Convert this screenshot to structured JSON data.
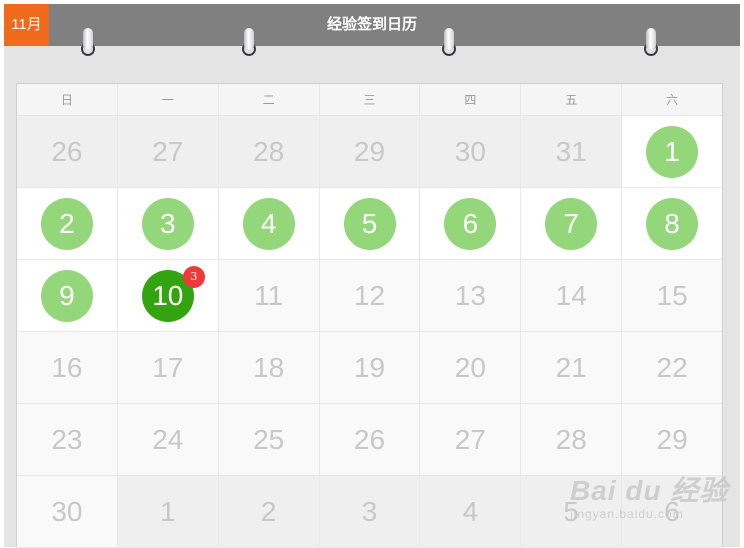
{
  "header": {
    "month_label": "11月",
    "title": "经验签到日历"
  },
  "weekdays": [
    "日",
    "一",
    "二",
    "三",
    "四",
    "五",
    "六"
  ],
  "weeks": [
    [
      {
        "label": "26",
        "status": "other"
      },
      {
        "label": "27",
        "status": "other"
      },
      {
        "label": "28",
        "status": "other"
      },
      {
        "label": "29",
        "status": "other"
      },
      {
        "label": "30",
        "status": "other"
      },
      {
        "label": "31",
        "status": "other"
      },
      {
        "label": "1",
        "status": "signed"
      }
    ],
    [
      {
        "label": "2",
        "status": "signed"
      },
      {
        "label": "3",
        "status": "signed"
      },
      {
        "label": "4",
        "status": "signed"
      },
      {
        "label": "5",
        "status": "signed"
      },
      {
        "label": "6",
        "status": "signed"
      },
      {
        "label": "7",
        "status": "signed"
      },
      {
        "label": "8",
        "status": "signed"
      }
    ],
    [
      {
        "label": "9",
        "status": "signed"
      },
      {
        "label": "10",
        "status": "today",
        "badge": "3"
      },
      {
        "label": "11",
        "status": "future"
      },
      {
        "label": "12",
        "status": "future"
      },
      {
        "label": "13",
        "status": "future"
      },
      {
        "label": "14",
        "status": "future"
      },
      {
        "label": "15",
        "status": "future"
      }
    ],
    [
      {
        "label": "16",
        "status": "future"
      },
      {
        "label": "17",
        "status": "future"
      },
      {
        "label": "18",
        "status": "future"
      },
      {
        "label": "19",
        "status": "future"
      },
      {
        "label": "20",
        "status": "future"
      },
      {
        "label": "21",
        "status": "future"
      },
      {
        "label": "22",
        "status": "future"
      }
    ],
    [
      {
        "label": "23",
        "status": "future"
      },
      {
        "label": "24",
        "status": "future"
      },
      {
        "label": "25",
        "status": "future"
      },
      {
        "label": "26",
        "status": "future"
      },
      {
        "label": "27",
        "status": "future"
      },
      {
        "label": "28",
        "status": "future"
      },
      {
        "label": "29",
        "status": "future"
      }
    ],
    [
      {
        "label": "30",
        "status": "future"
      },
      {
        "label": "1",
        "status": "other"
      },
      {
        "label": "2",
        "status": "other"
      },
      {
        "label": "3",
        "status": "other"
      },
      {
        "label": "4",
        "status": "other"
      },
      {
        "label": "5",
        "status": "other"
      },
      {
        "label": "6",
        "status": "other"
      }
    ]
  ],
  "watermark": {
    "logo": "Bai du 经验",
    "url": "jingyan.baidu.com"
  },
  "colors": {
    "header_bg": "#808080",
    "month_badge_bg": "#f06a1b",
    "signed": "#94d67a",
    "today": "#33a30f",
    "badge": "#f03a3a"
  }
}
